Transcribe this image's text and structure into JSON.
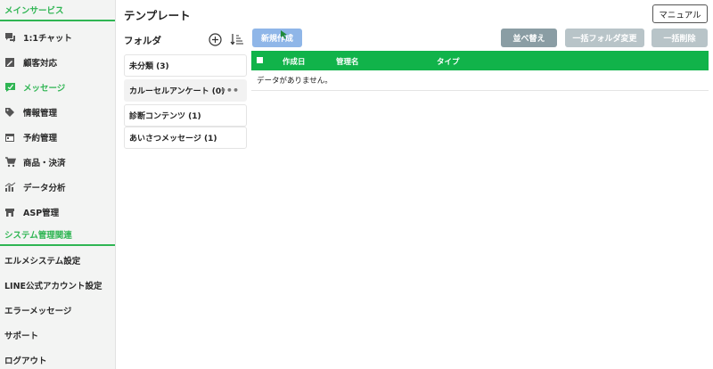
{
  "sidebar": {
    "main_section": "メインサービス",
    "items": [
      {
        "label": "1:1チャット",
        "icon": "chat-icon"
      },
      {
        "label": "顧客対応",
        "icon": "edit-square-icon"
      },
      {
        "label": "メッセージ",
        "icon": "message-icon"
      },
      {
        "label": "情報管理",
        "icon": "tag-icon"
      },
      {
        "label": "予約管理",
        "icon": "calendar-icon"
      },
      {
        "label": "商品・決済",
        "icon": "cart-icon"
      },
      {
        "label": "データ分析",
        "icon": "chart-icon"
      },
      {
        "label": "ASP管理",
        "icon": "store-icon"
      }
    ],
    "system_section": "システム管理関連",
    "system_items": [
      {
        "label": "エルメシステム設定"
      },
      {
        "label": "LINE公式アカウント設定"
      },
      {
        "label": "エラーメッセージ"
      },
      {
        "label": "サポート"
      },
      {
        "label": "ログアウト"
      }
    ],
    "active_color": "#2fb553"
  },
  "header": {
    "title": "テンプレート",
    "manual_label": "マニュアル"
  },
  "folders": {
    "heading": "フォルダ",
    "items": [
      {
        "label": "未分類 (3)"
      },
      {
        "label": "カルーセルアンケート (0)"
      },
      {
        "label": "診断コンテンツ (1)"
      },
      {
        "label": "あいさつメッセージ (1)"
      }
    ],
    "more_label": "•••"
  },
  "toolbar": {
    "new_label": "新規作成",
    "sort_label": "並べ替え",
    "bulk_folder_label": "一括フォルダ変更",
    "bulk_delete_label": "一括削除"
  },
  "table": {
    "columns": [
      "作成日",
      "管理名",
      "タイプ"
    ],
    "empty_message": "データがありません。",
    "header_color": "#11b34a"
  }
}
